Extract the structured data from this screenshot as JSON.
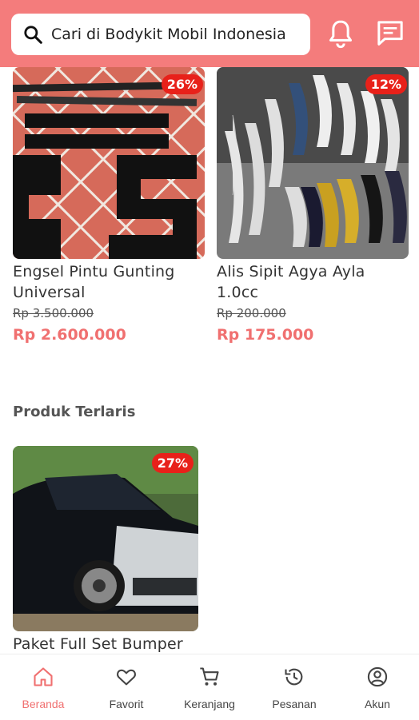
{
  "search": {
    "placeholder": "Cari di Bodykit Mobil Indonesia"
  },
  "products": [
    {
      "discount": "26%",
      "title_line1": "Engsel Pintu Gunting",
      "title_line2": "Universal",
      "old_price": "Rp 3.500.000",
      "price": "Rp 2.600.000"
    },
    {
      "discount": "12%",
      "title_line1": "Alis Sipit Agya Ayla",
      "title_line2": "1.0cc",
      "old_price": "Rp 200.000",
      "price": "Rp 175.000"
    }
  ],
  "best_seller": {
    "section_title": "Produk Terlaris",
    "items": [
      {
        "discount": "27%",
        "title": "Paket Full Set Bumper"
      }
    ]
  },
  "bottom_nav": [
    {
      "label": "Beranda",
      "icon": "home-icon",
      "active": true
    },
    {
      "label": "Favorit",
      "icon": "heart-icon",
      "active": false
    },
    {
      "label": "Keranjang",
      "icon": "cart-icon",
      "active": false
    },
    {
      "label": "Pesanan",
      "icon": "history-icon",
      "active": false
    },
    {
      "label": "Akun",
      "icon": "account-icon",
      "active": false
    }
  ],
  "colors": {
    "header": "#f47c7c",
    "accent": "#f07070",
    "badge": "#e8211a"
  }
}
